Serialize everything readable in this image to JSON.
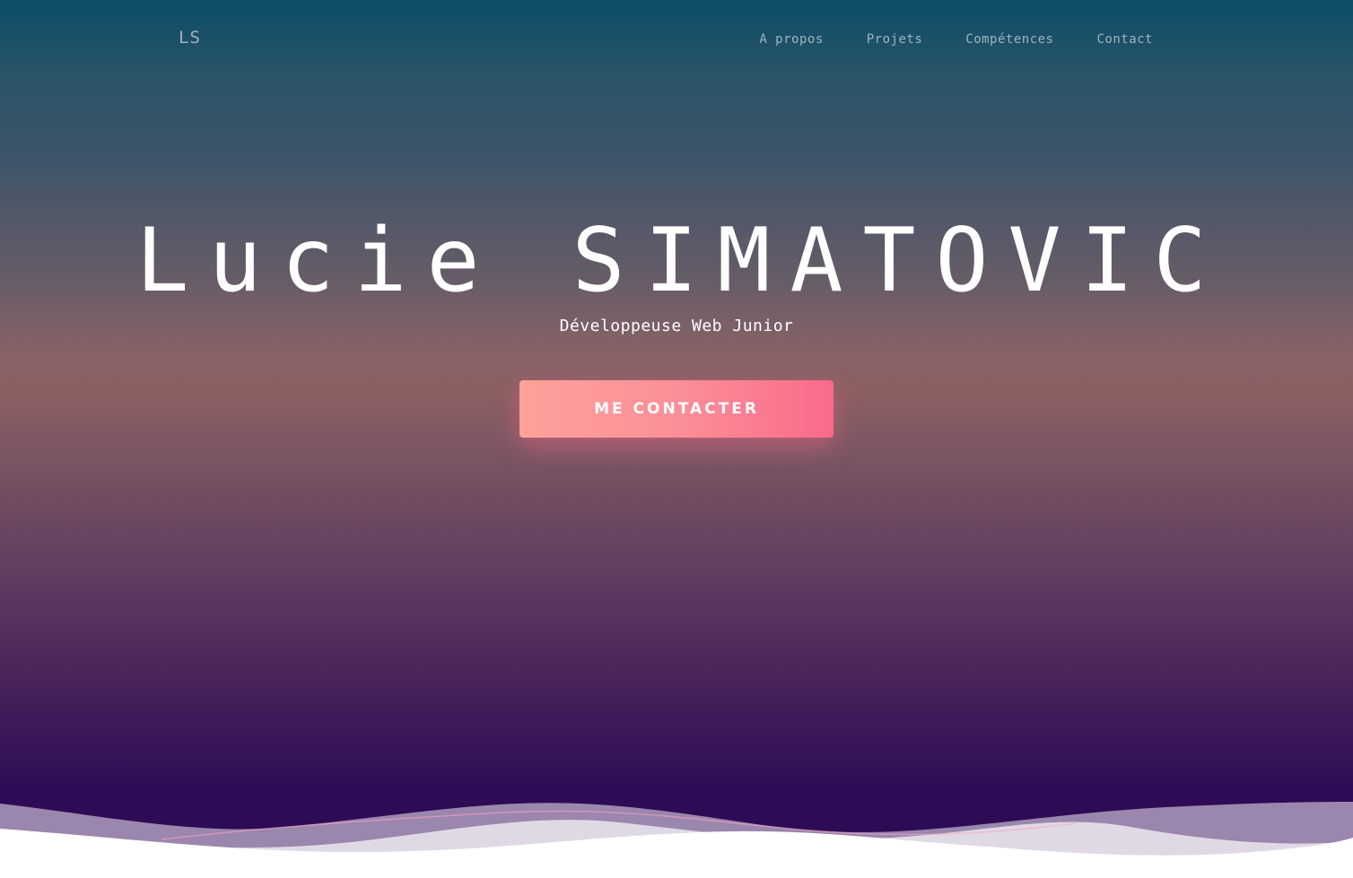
{
  "header": {
    "logo": "LS",
    "nav": [
      {
        "label": "A propos"
      },
      {
        "label": "Projets"
      },
      {
        "label": "Compétences"
      },
      {
        "label": "Contact"
      }
    ]
  },
  "hero": {
    "title": "Lucie SIMATOVIC",
    "subtitle": "Développeuse Web Junior",
    "cta_label": "ME CONTACTER"
  },
  "colors": {
    "accent_start": "#fca29a",
    "accent_end": "#fa6a8a",
    "background_top": "#0c4d67",
    "background_bottom": "#2c0b56"
  }
}
